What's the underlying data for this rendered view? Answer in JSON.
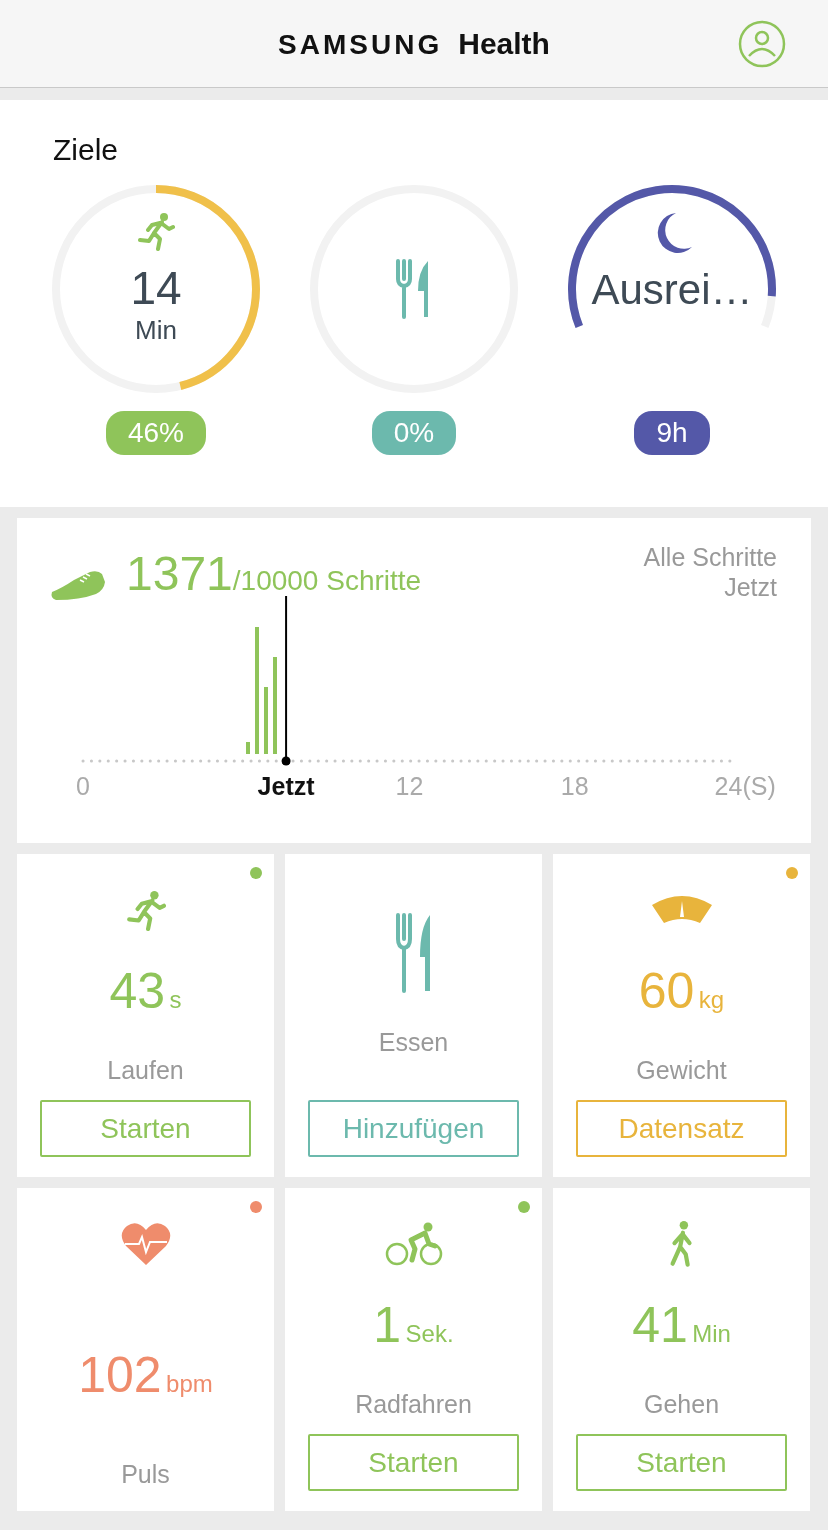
{
  "header": {
    "brand": "SAMSUNG",
    "product": "Health"
  },
  "goals": {
    "title": "Ziele",
    "items": [
      {
        "kind": "exercise",
        "value": "14",
        "unit": "Min",
        "badge": "46%",
        "color": "#8fc45a"
      },
      {
        "kind": "food",
        "badge": "0%",
        "color": "#6cb9ad"
      },
      {
        "kind": "sleep",
        "value": "Ausrei…",
        "badge": "9h",
        "color": "#5458a8"
      }
    ]
  },
  "steps": {
    "count": "1371",
    "goal": "/10000 Schritte",
    "link": "Alle Schritte",
    "time": "Jetzt",
    "axis": [
      {
        "label": "0",
        "current": false
      },
      {
        "label": "Jetzt",
        "current": true
      },
      {
        "label": "12",
        "current": false
      },
      {
        "label": "18",
        "current": false
      },
      {
        "label": "24(S)",
        "current": false
      }
    ]
  },
  "tiles": [
    {
      "kind": "running",
      "value": "43",
      "unit": "s",
      "label": "Laufen",
      "button": "Starten",
      "color": "#8fc45a",
      "dot": true
    },
    {
      "kind": "food",
      "label": "Essen",
      "button": "Hinzufügen",
      "color": "#6cb9ad",
      "dot": false
    },
    {
      "kind": "weight",
      "value": "60",
      "unit": "kg",
      "label": "Gewicht",
      "button": "Datensatz",
      "color": "#e8b43c",
      "dot": true
    },
    {
      "kind": "heart",
      "value": "102",
      "unit": "bpm",
      "label": "Puls",
      "color": "#ef8c6c",
      "dot": true
    },
    {
      "kind": "cycling",
      "value": "1",
      "unit": "Sek.",
      "label": "Radfahren",
      "button": "Starten",
      "color": "#8fc45a",
      "dot": true
    },
    {
      "kind": "walking",
      "value": "41",
      "unit": "Min",
      "label": "Gehen",
      "button": "Starten",
      "color": "#8fc45a",
      "dot": false
    }
  ]
}
